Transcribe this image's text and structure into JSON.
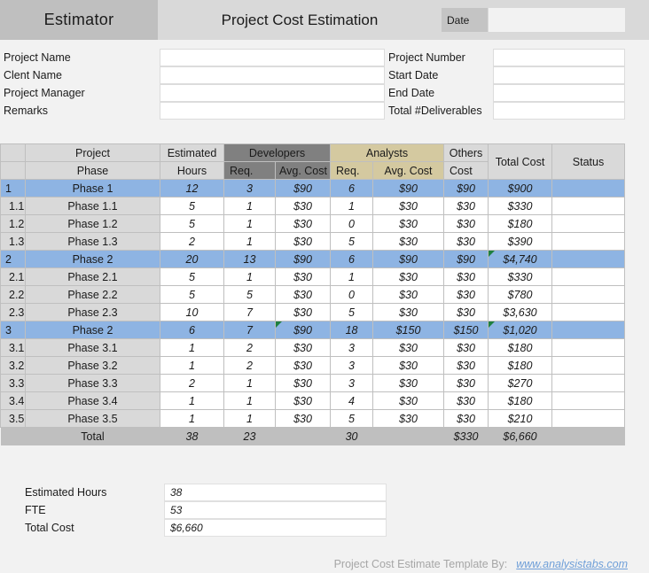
{
  "titlebar": {
    "app_name": "Estimator",
    "title": "Project Cost Estimation",
    "date_label": "Date",
    "date_value": ""
  },
  "form": {
    "left": [
      {
        "label": "Project Name",
        "value": ""
      },
      {
        "label": "Clent Name",
        "value": ""
      },
      {
        "label": "Project Manager",
        "value": ""
      },
      {
        "label": "Remarks",
        "value": ""
      }
    ],
    "right": [
      {
        "label": "Project Number",
        "value": ""
      },
      {
        "label": "Start Date",
        "value": ""
      },
      {
        "label": "End Date",
        "value": ""
      },
      {
        "label": "Total #Deliverables",
        "value": ""
      }
    ]
  },
  "table": {
    "header_top": {
      "num": "",
      "project": "Project",
      "estimated": "Estimated",
      "developers": "Developers",
      "analysts": "Analysts",
      "others": "Others",
      "total_cost": "Total Cost",
      "status": "Status"
    },
    "header_bottom": {
      "num": "",
      "phase": "Phase",
      "hours": "Hours",
      "dev_req": "Req.",
      "dev_cost": "Avg. Cost",
      "ana_req": "Req.",
      "ana_cost": "Avg. Cost",
      "others_cost": "Cost",
      "total_cost": "",
      "status": ""
    },
    "rows": [
      {
        "type": "main",
        "num": "1",
        "name": "Phase 1",
        "hours": "12",
        "dev_req": "3",
        "dev_cost": "$90",
        "ana_req": "6",
        "ana_cost": "$90",
        "others": "$90",
        "total": "$900",
        "status": "",
        "comments": []
      },
      {
        "type": "sub",
        "num": "1.1",
        "name": "Phase 1.1",
        "hours": "5",
        "dev_req": "1",
        "dev_cost": "$30",
        "ana_req": "1",
        "ana_cost": "$30",
        "others": "$30",
        "total": "$330",
        "status": "",
        "comments": []
      },
      {
        "type": "sub",
        "num": "1.2",
        "name": "Phase 1.2",
        "hours": "5",
        "dev_req": "1",
        "dev_cost": "$30",
        "ana_req": "0",
        "ana_cost": "$30",
        "others": "$30",
        "total": "$180",
        "status": "",
        "comments": []
      },
      {
        "type": "sub",
        "num": "1.3",
        "name": "Phase 1.3",
        "hours": "2",
        "dev_req": "1",
        "dev_cost": "$30",
        "ana_req": "5",
        "ana_cost": "$30",
        "others": "$30",
        "total": "$390",
        "status": "",
        "comments": []
      },
      {
        "type": "main",
        "num": "2",
        "name": "Phase 2",
        "hours": "20",
        "dev_req": "13",
        "dev_cost": "$90",
        "ana_req": "6",
        "ana_cost": "$90",
        "others": "$90",
        "total": "$4,740",
        "status": "",
        "comments": [
          "total"
        ]
      },
      {
        "type": "sub",
        "num": "2.1",
        "name": "Phase 2.1",
        "hours": "5",
        "dev_req": "1",
        "dev_cost": "$30",
        "ana_req": "1",
        "ana_cost": "$30",
        "others": "$30",
        "total": "$330",
        "status": "",
        "comments": []
      },
      {
        "type": "sub",
        "num": "2.2",
        "name": "Phase 2.2",
        "hours": "5",
        "dev_req": "5",
        "dev_cost": "$30",
        "ana_req": "0",
        "ana_cost": "$30",
        "others": "$30",
        "total": "$780",
        "status": "",
        "comments": []
      },
      {
        "type": "sub",
        "num": "2.3",
        "name": "Phase 2.3",
        "hours": "10",
        "dev_req": "7",
        "dev_cost": "$30",
        "ana_req": "5",
        "ana_cost": "$30",
        "others": "$30",
        "total": "$3,630",
        "status": "",
        "comments": []
      },
      {
        "type": "main",
        "num": "3",
        "name": "Phase 2",
        "hours": "6",
        "dev_req": "7",
        "dev_cost": "$90",
        "ana_req": "18",
        "ana_cost": "$150",
        "others": "$150",
        "total": "$1,020",
        "status": "",
        "comments": [
          "dev_cost",
          "total"
        ]
      },
      {
        "type": "sub",
        "num": "3.1",
        "name": "Phase 3.1",
        "hours": "1",
        "dev_req": "2",
        "dev_cost": "$30",
        "ana_req": "3",
        "ana_cost": "$30",
        "others": "$30",
        "total": "$180",
        "status": "",
        "comments": []
      },
      {
        "type": "sub",
        "num": "3.2",
        "name": "Phase 3.2",
        "hours": "1",
        "dev_req": "2",
        "dev_cost": "$30",
        "ana_req": "3",
        "ana_cost": "$30",
        "others": "$30",
        "total": "$180",
        "status": "",
        "comments": []
      },
      {
        "type": "sub",
        "num": "3.3",
        "name": "Phase 3.3",
        "hours": "2",
        "dev_req": "1",
        "dev_cost": "$30",
        "ana_req": "3",
        "ana_cost": "$30",
        "others": "$30",
        "total": "$270",
        "status": "",
        "comments": []
      },
      {
        "type": "sub",
        "num": "3.4",
        "name": "Phase 3.4",
        "hours": "1",
        "dev_req": "1",
        "dev_cost": "$30",
        "ana_req": "4",
        "ana_cost": "$30",
        "others": "$30",
        "total": "$180",
        "status": "",
        "comments": []
      },
      {
        "type": "sub",
        "num": "3.5",
        "name": "Phase 3.5",
        "hours": "1",
        "dev_req": "1",
        "dev_cost": "$30",
        "ana_req": "5",
        "ana_cost": "$30",
        "others": "$30",
        "total": "$210",
        "status": "",
        "comments": []
      },
      {
        "type": "total",
        "num": "",
        "name": "Total",
        "hours": "38",
        "dev_req": "23",
        "dev_cost": "",
        "ana_req": "30",
        "ana_cost": "",
        "others": "$330",
        "total": "$6,660",
        "status": "",
        "comments": []
      }
    ]
  },
  "summary": [
    {
      "label": "Estimated Hours",
      "value": "38"
    },
    {
      "label": "FTE",
      "value": "53"
    },
    {
      "label": "Total Cost",
      "value": "$6,660"
    }
  ],
  "footer": {
    "text": "Project Cost Estimate Template By:",
    "link": "www.analysistabs.com"
  },
  "colors": {
    "main_row": "#8eb4e3",
    "developers_header": "#808080",
    "analysts_header": "#d4c9a0",
    "total_row": "#bfbfbf",
    "comment_marker": "#1e8040",
    "link": "#6f9fd8"
  }
}
